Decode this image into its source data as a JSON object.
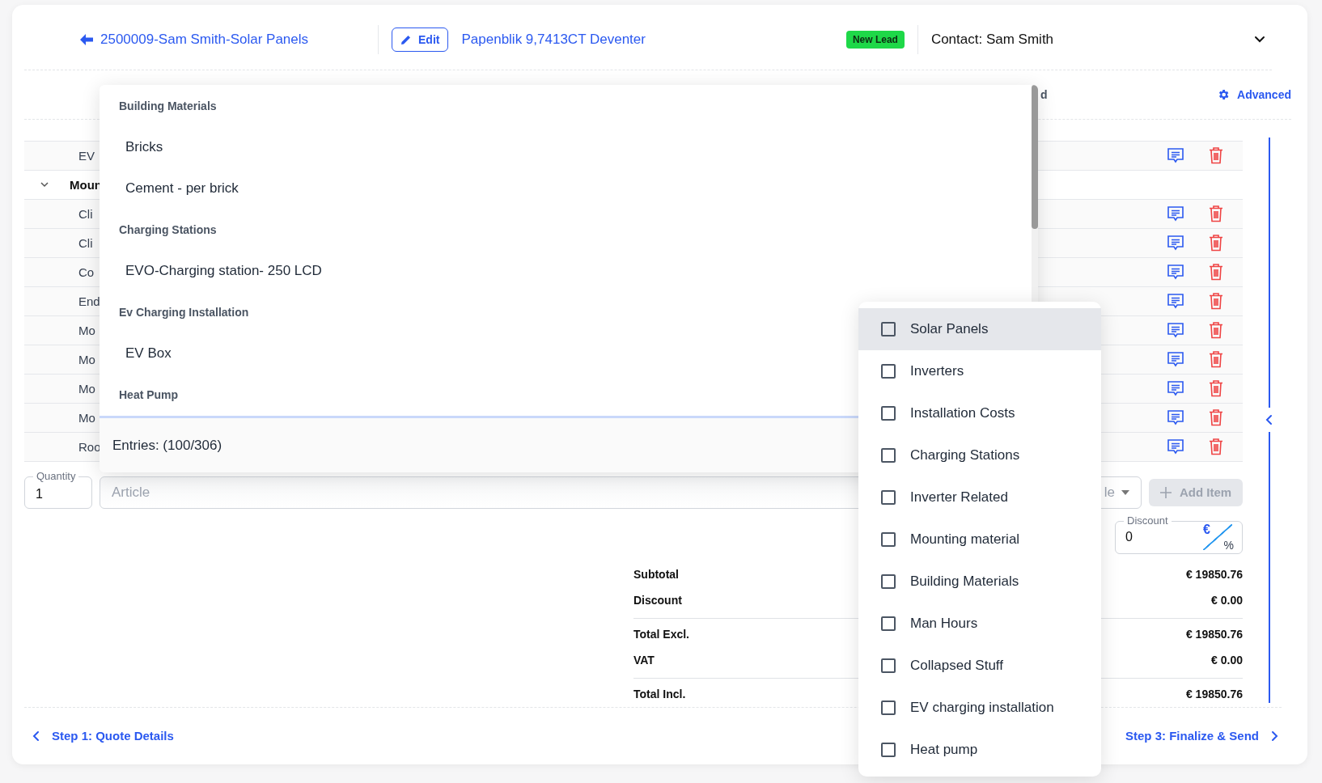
{
  "header": {
    "title": "2500009-Sam Smith-Solar Panels",
    "edit_button": "Edit",
    "address": "Papenblik 9,7413CT Deventer",
    "status_badge": "New Lead",
    "contact": "Contact: Sam Smith"
  },
  "toolbar": {
    "column_fragment": "d",
    "advanced_button": "Advanced"
  },
  "table": {
    "rows": [
      {
        "kind": "item",
        "text": "EV"
      },
      {
        "kind": "group",
        "text": "Moun",
        "expanded": true
      },
      {
        "kind": "item",
        "text": "Cli"
      },
      {
        "kind": "item",
        "text": "Cli"
      },
      {
        "kind": "item",
        "text": "Co"
      },
      {
        "kind": "item",
        "text": "End"
      },
      {
        "kind": "item",
        "text": "Mo"
      },
      {
        "kind": "item",
        "text": "Mo"
      },
      {
        "kind": "item",
        "text": "Mo"
      },
      {
        "kind": "item",
        "text": "Mo"
      },
      {
        "kind": "item",
        "text": "Roo"
      }
    ]
  },
  "add_item": {
    "quantity": {
      "label": "Quantity",
      "value": "1"
    },
    "article": {
      "placeholder": "Article"
    },
    "unit": "le",
    "add_button": {
      "label": "Add Item",
      "disabled": true
    }
  },
  "discount": {
    "label": "Discount",
    "value": "0",
    "currency_symbol": "€",
    "percent_symbol": "%"
  },
  "totals": [
    {
      "label": "Subtotal",
      "value": "€ 19850.76",
      "rule_above": false
    },
    {
      "label": "Discount",
      "value": "€ 0.00",
      "rule_above": false
    },
    {
      "label": "Total Excl.",
      "value": "€ 19850.76",
      "rule_above": true
    },
    {
      "label": "VAT",
      "value": "€ 0.00",
      "rule_above": false
    },
    {
      "label": "Total Incl.",
      "value": "€ 19850.76",
      "rule_above": true
    }
  ],
  "footer": {
    "back": "Step 1: Quote Details",
    "next": "Step 3: Finalize & Send"
  },
  "article_dropdown": {
    "groups": [
      {
        "label": "Building Materials",
        "items": [
          "Bricks",
          "Cement - per brick"
        ]
      },
      {
        "label": "Charging Stations",
        "items": [
          "EVO-Charging station- 250 LCD"
        ]
      },
      {
        "label": "Ev Charging Installation",
        "items": [
          "EV Box"
        ]
      },
      {
        "label": "Heat Pump"
      }
    ],
    "entries": "Entries: (100/306)"
  },
  "category_menu": {
    "items": [
      {
        "label": "Solar Panels",
        "checked": false,
        "selected": true
      },
      {
        "label": "Inverters",
        "checked": false,
        "selected": false
      },
      {
        "label": "Installation Costs",
        "checked": false,
        "selected": false
      },
      {
        "label": "Charging Stations",
        "checked": false,
        "selected": false
      },
      {
        "label": "Inverter Related",
        "checked": false,
        "selected": false
      },
      {
        "label": "Mounting material",
        "checked": false,
        "selected": false
      },
      {
        "label": "Building Materials",
        "checked": false,
        "selected": false
      },
      {
        "label": "Man Hours",
        "checked": false,
        "selected": false
      },
      {
        "label": "Collapsed Stuff",
        "checked": false,
        "selected": false
      },
      {
        "label": "EV charging installation",
        "checked": false,
        "selected": false
      },
      {
        "label": "Heat pump",
        "checked": false,
        "selected": false
      }
    ]
  }
}
